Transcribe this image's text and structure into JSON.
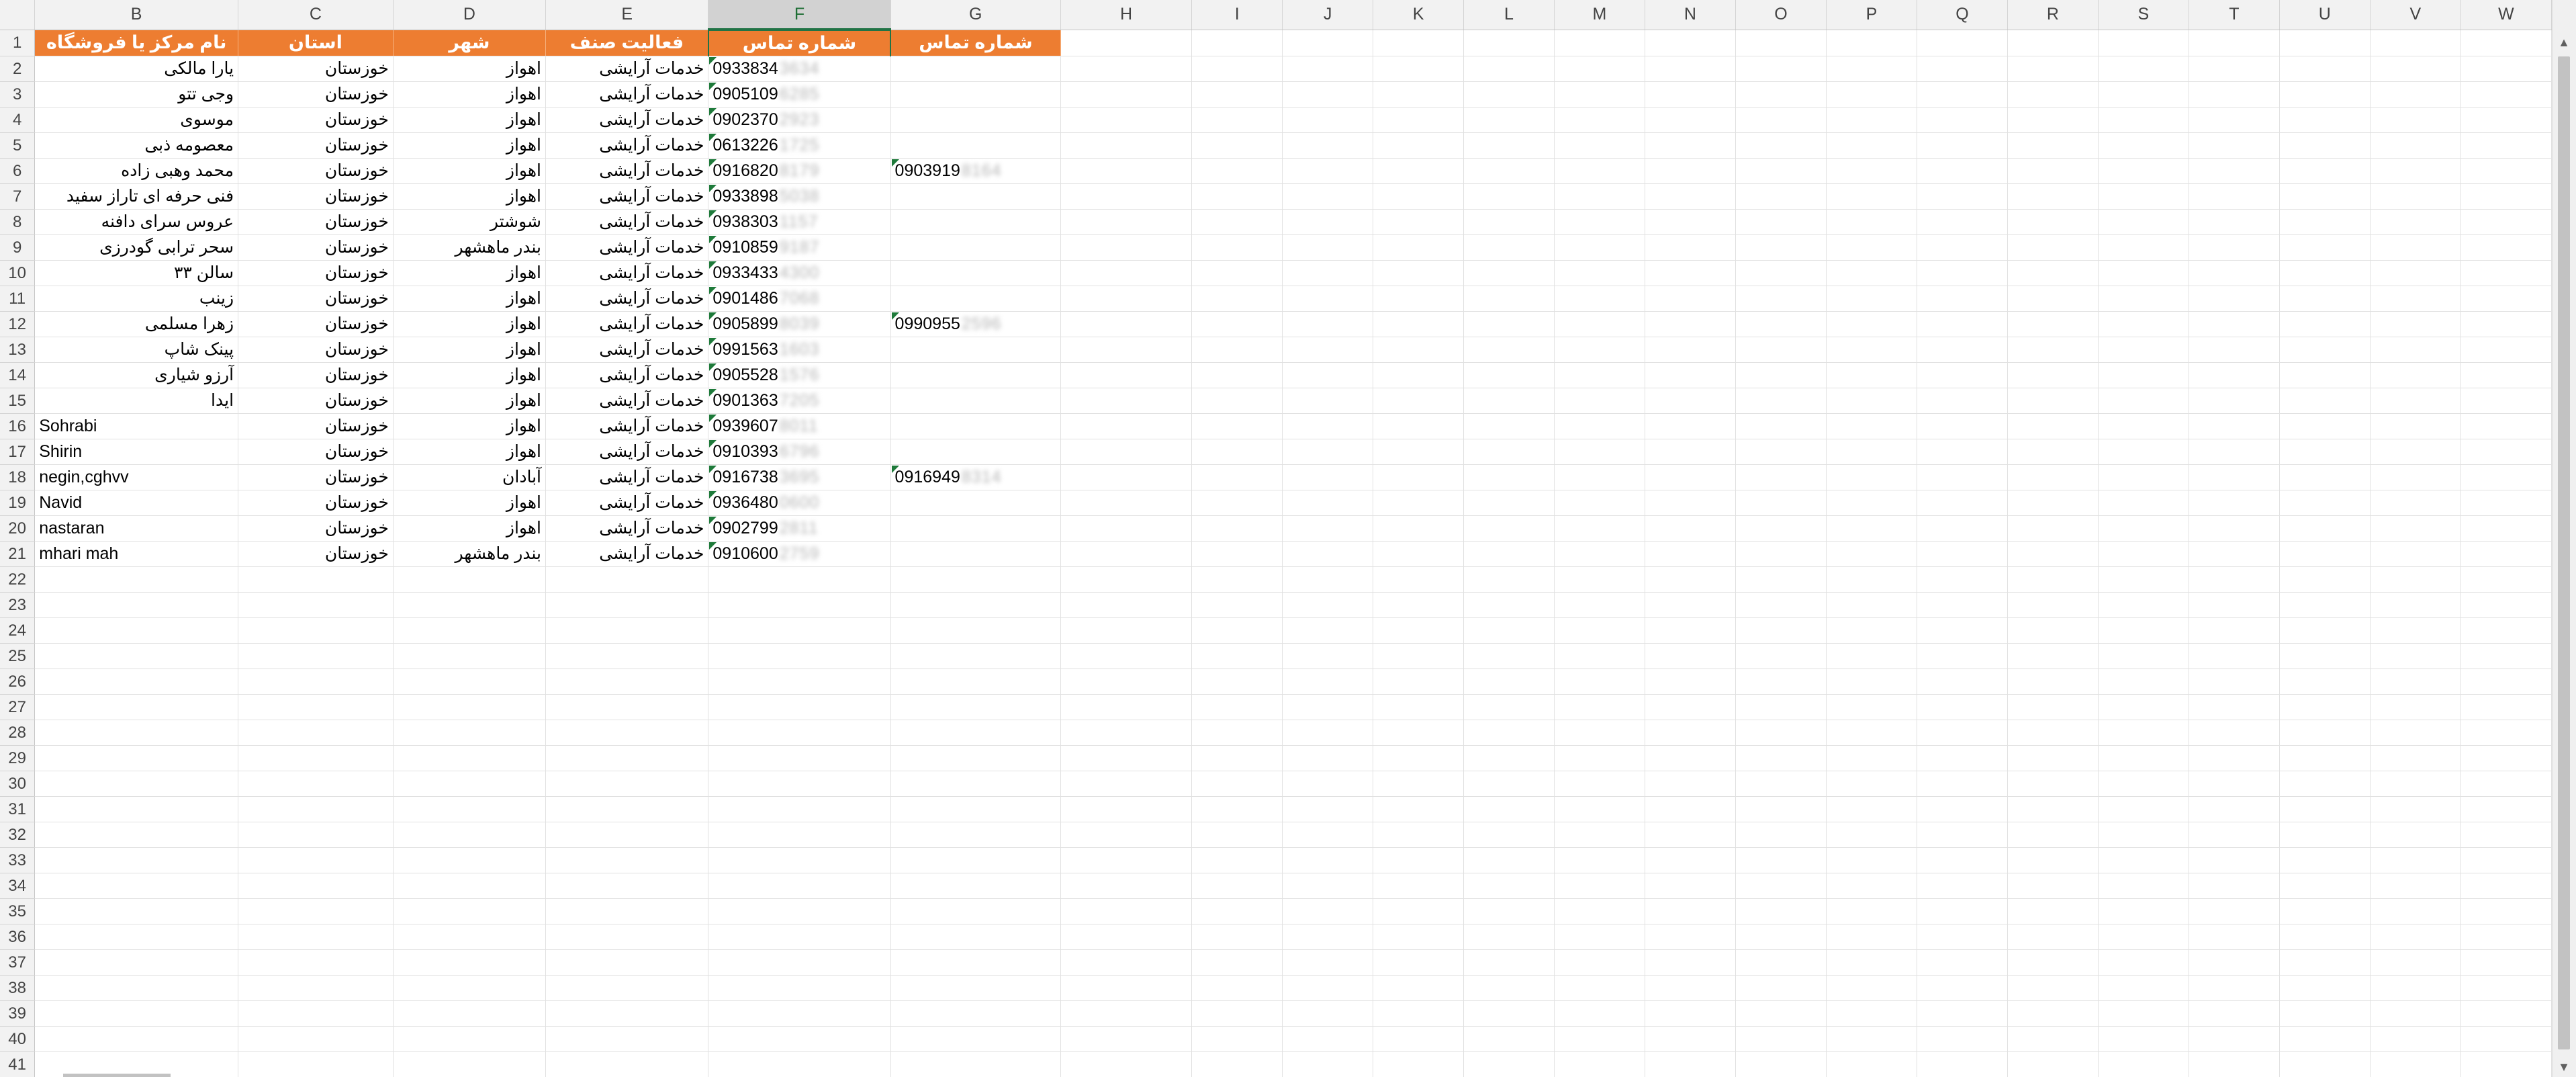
{
  "columns": [
    "B",
    "C",
    "D",
    "E",
    "F",
    "G",
    "H",
    "I",
    "J",
    "K",
    "L",
    "M",
    "N",
    "O",
    "P",
    "Q",
    "R",
    "S",
    "T",
    "U",
    "V",
    "W"
  ],
  "header_row": {
    "B": "نام مرکز یا فروشگاه",
    "C": "استان",
    "D": "شهر",
    "E": "فعالیت صنف",
    "F": "شماره تماس",
    "G": "شماره تماس"
  },
  "rows": [
    {
      "name": "یارا مالکی",
      "province": "خوزستان",
      "city": "اهواز",
      "activity": "خدمات آرایشی",
      "phone": "0933834",
      "phone_blur": "3634",
      "phone2": "",
      "phone2_blur": ""
    },
    {
      "name": "وجی تتو",
      "province": "خوزستان",
      "city": "اهواز",
      "activity": "خدمات آرایشی",
      "phone": "0905109",
      "phone_blur": "6285",
      "phone2": "",
      "phone2_blur": ""
    },
    {
      "name": "موسوی",
      "province": "خوزستان",
      "city": "اهواز",
      "activity": "خدمات آرایشی",
      "phone": "0902370",
      "phone_blur": "2923",
      "phone2": "",
      "phone2_blur": ""
    },
    {
      "name": "معصومه ذبی",
      "province": "خوزستان",
      "city": "اهواز",
      "activity": "خدمات آرایشی",
      "phone": "0613226",
      "phone_blur": "1725",
      "phone2": "",
      "phone2_blur": ""
    },
    {
      "name": "محمد وهبی زاده",
      "province": "خوزستان",
      "city": "اهواز",
      "activity": "خدمات آرایشی",
      "phone": "0916820",
      "phone_blur": "8179",
      "phone2": "0903919",
      "phone2_blur": "8164"
    },
    {
      "name": "فنی حرفه ای تاراز سفید",
      "province": "خوزستان",
      "city": "اهواز",
      "activity": "خدمات آرایشی",
      "phone": "0933898",
      "phone_blur": "5038",
      "phone2": "",
      "phone2_blur": ""
    },
    {
      "name": "عروس سرای دافنه",
      "province": "خوزستان",
      "city": "شوشتر",
      "activity": "خدمات آرایشی",
      "phone": "0938303",
      "phone_blur": "1157",
      "phone2": "",
      "phone2_blur": ""
    },
    {
      "name": "سحر ترابی گودرزی",
      "province": "خوزستان",
      "city": "بندر ماهشهر",
      "activity": "خدمات آرایشی",
      "phone": "0910859",
      "phone_blur": "9187",
      "phone2": "",
      "phone2_blur": ""
    },
    {
      "name": "سالن ۳۳",
      "province": "خوزستان",
      "city": "اهواز",
      "activity": "خدمات آرایشی",
      "phone": "0933433",
      "phone_blur": "4300",
      "phone2": "",
      "phone2_blur": ""
    },
    {
      "name": "زینب",
      "province": "خوزستان",
      "city": "اهواز",
      "activity": "خدمات آرایشی",
      "phone": "0901486",
      "phone_blur": "7068",
      "phone2": "",
      "phone2_blur": ""
    },
    {
      "name": "زهرا مسلمی",
      "province": "خوزستان",
      "city": "اهواز",
      "activity": "خدمات آرایشی",
      "phone": "0905899",
      "phone_blur": "8039",
      "phone2": "0990955",
      "phone2_blur": "2596"
    },
    {
      "name": "پینک شاپ",
      "province": "خوزستان",
      "city": "اهواز",
      "activity": "خدمات آرایشی",
      "phone": "0991563",
      "phone_blur": "1603",
      "phone2": "",
      "phone2_blur": ""
    },
    {
      "name": "آرزو شیاری",
      "province": "خوزستان",
      "city": "اهواز",
      "activity": "خدمات آرایشی",
      "phone": "0905528",
      "phone_blur": "1576",
      "phone2": "",
      "phone2_blur": ""
    },
    {
      "name": "ایدا",
      "province": "خوزستان",
      "city": "اهواز",
      "activity": "خدمات آرایشی",
      "phone": "0901363",
      "phone_blur": "7205",
      "phone2": "",
      "phone2_blur": ""
    },
    {
      "name": "Sohrabi",
      "province": "خوزستان",
      "city": "اهواز",
      "activity": "خدمات آرایشی",
      "phone": "0939607",
      "phone_blur": "8011",
      "phone2": "",
      "phone2_blur": ""
    },
    {
      "name": "Shirin",
      "province": "خوزستان",
      "city": "اهواز",
      "activity": "خدمات آرایشی",
      "phone": "0910393",
      "phone_blur": "6796",
      "phone2": "",
      "phone2_blur": ""
    },
    {
      "name": "negin,cghvv",
      "province": "خوزستان",
      "city": "آبادان",
      "activity": "خدمات آرایشی",
      "phone": "0916738",
      "phone_blur": "3695",
      "phone2": "0916949",
      "phone2_blur": "8314"
    },
    {
      "name": "Navid",
      "province": "خوزستان",
      "city": "اهواز",
      "activity": "خدمات آرایشی",
      "phone": "0936480",
      "phone_blur": "0600",
      "phone2": "",
      "phone2_blur": ""
    },
    {
      "name": "nastaran",
      "province": "خوزستان",
      "city": "اهواز",
      "activity": "خدمات آرایشی",
      "phone": "0902799",
      "phone_blur": "2811",
      "phone2": "",
      "phone2_blur": ""
    },
    {
      "name": "mhari mah",
      "province": "خوزستان",
      "city": "بندر ماهشهر",
      "activity": "خدمات آرایشی",
      "phone": "0910600",
      "phone_blur": "2759",
      "phone2": "",
      "phone2_blur": ""
    }
  ],
  "empty_row_start": 22,
  "empty_row_end": 41,
  "selected_column": "F",
  "colors": {
    "header_fill": "#ed7d31",
    "header_text": "#ffffff",
    "selection": "#217346",
    "error_marker": "#1e7a3a"
  }
}
